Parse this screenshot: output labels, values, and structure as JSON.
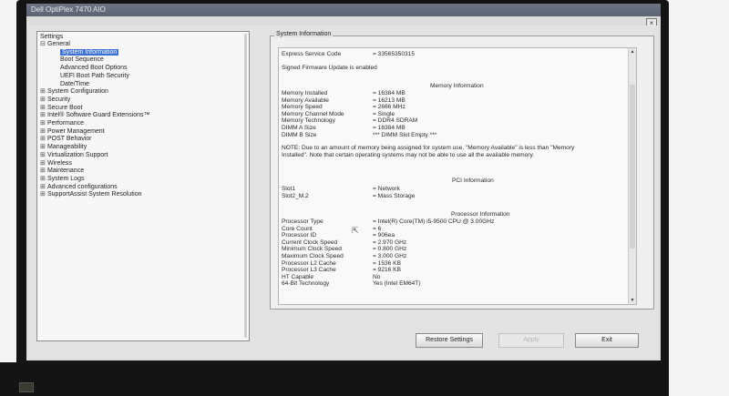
{
  "window": {
    "title": "Dell OptiPlex 7470 AIO",
    "close_label": "×"
  },
  "tree": {
    "header": "Settings",
    "items": [
      {
        "label": "General",
        "expander": "⊟",
        "level": 0
      },
      {
        "label": "System Information",
        "expander": "",
        "level": 1,
        "selected": true
      },
      {
        "label": "Boot Sequence",
        "expander": "",
        "level": 1
      },
      {
        "label": "Advanced Boot Options",
        "expander": "",
        "level": 1
      },
      {
        "label": "UEFI Boot Path Security",
        "expander": "",
        "level": 1
      },
      {
        "label": "Date/Time",
        "expander": "",
        "level": 1
      },
      {
        "label": "System Configuration",
        "expander": "⊞",
        "level": 0
      },
      {
        "label": "Security",
        "expander": "⊞",
        "level": 0
      },
      {
        "label": "Secure Boot",
        "expander": "⊞",
        "level": 0
      },
      {
        "label": "Intel® Software Guard Extensions™",
        "expander": "⊞",
        "level": 0
      },
      {
        "label": "Performance",
        "expander": "⊞",
        "level": 0
      },
      {
        "label": "Power Management",
        "expander": "⊞",
        "level": 0
      },
      {
        "label": "POST Behavior",
        "expander": "⊞",
        "level": 0
      },
      {
        "label": "Manageability",
        "expander": "⊞",
        "level": 0
      },
      {
        "label": "Virtualization Support",
        "expander": "⊞",
        "level": 0
      },
      {
        "label": "Wireless",
        "expander": "⊞",
        "level": 0
      },
      {
        "label": "Maintenance",
        "expander": "⊞",
        "level": 0
      },
      {
        "label": "System Logs",
        "expander": "⊞",
        "level": 0
      },
      {
        "label": "Advanced configurations",
        "expander": "⊞",
        "level": 0
      },
      {
        "label": "SupportAssist System Resolution",
        "expander": "⊞",
        "level": 0
      }
    ]
  },
  "panel": {
    "legend": "System Information",
    "express_service_code": {
      "key": "Express Service Code",
      "value": "= 33565350315"
    },
    "firmware_note": "Signed Firmware Update is enabled",
    "memory": {
      "heading": "Memory Information",
      "rows": [
        {
          "k": "Memory Installed",
          "v": "= 16384 MB"
        },
        {
          "k": "Memory Available",
          "v": "= 16213 MB"
        },
        {
          "k": "Memory Speed",
          "v": "= 2666 MHz"
        },
        {
          "k": "Memory Channel Mode",
          "v": "= Single"
        },
        {
          "k": "Memory Technology",
          "v": "= DDR4 SDRAM"
        },
        {
          "k": "DIMM A Size",
          "v": "= 16384 MB"
        },
        {
          "k": "DIMM B Size",
          "v": "*** DIMM Slot Empty ***"
        }
      ],
      "note": "NOTE: Due to an amount of memory being assigned for system use, \"Memory Available\" is less than \"Memory Installed\". Note that certain operating systems may not be able to use all the available memory."
    },
    "pci": {
      "heading": "PCI Information",
      "rows": [
        {
          "k": "Slot1",
          "v": "= Network"
        },
        {
          "k": "Slot2_M.2",
          "v": "= Mass Storage"
        }
      ]
    },
    "processor": {
      "heading": "Processor Information",
      "rows": [
        {
          "k": "Processor Type",
          "v": "= Intel(R) Core(TM) i5-9500 CPU @ 3.00GHz"
        },
        {
          "k": "Core Count",
          "v": "= 6"
        },
        {
          "k": "Processor ID",
          "v": "= 906ea"
        },
        {
          "k": "Current Clock Speed",
          "v": "= 2.970 GHz"
        },
        {
          "k": "Minimum Clock Speed",
          "v": "= 0.800 GHz"
        },
        {
          "k": "Maximum Clock Speed",
          "v": "= 3.000 GHz"
        },
        {
          "k": "Processor L2 Cache",
          "v": "= 1536 KB"
        },
        {
          "k": "Processor L3 Cache",
          "v": "= 9216 KB"
        },
        {
          "k": "HT Capable",
          "v": "No"
        },
        {
          "k": "64-Bit Technology",
          "v": "Yes (Intel EM64T)"
        }
      ]
    }
  },
  "buttons": {
    "restore": "Restore Settings",
    "apply": "Apply",
    "exit": "Exit"
  },
  "colors": {
    "selection": "#3b6fd1",
    "titlebar": "#626a7b"
  }
}
